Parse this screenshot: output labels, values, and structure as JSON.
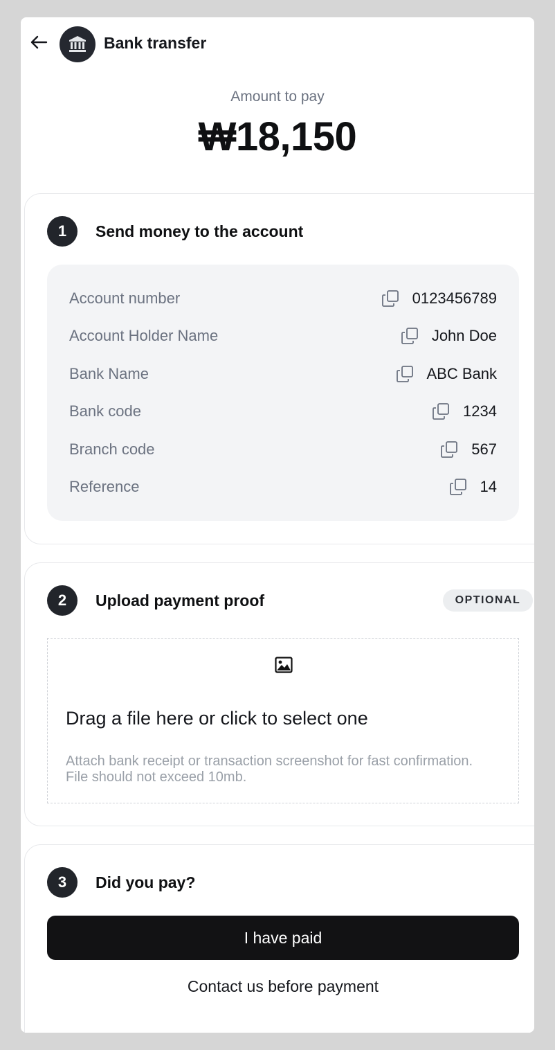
{
  "header": {
    "title": "Bank transfer",
    "back_icon": "arrow-left-icon",
    "avatar_icon": "bank-icon"
  },
  "amount": {
    "label": "Amount to pay",
    "value": "₩18,150"
  },
  "step1": {
    "number": "1",
    "title": "Send money to the account",
    "rows": [
      {
        "label": "Account number",
        "value": "0123456789",
        "icon": "copy-icon"
      },
      {
        "label": "Account Holder Name",
        "value": "John Doe",
        "icon": "copy-icon"
      },
      {
        "label": "Bank Name",
        "value": "ABC Bank",
        "icon": "copy-icon"
      },
      {
        "label": "Bank code",
        "value": "1234",
        "icon": "copy-icon"
      },
      {
        "label": "Branch code",
        "value": "567",
        "icon": "copy-icon"
      },
      {
        "label": "Reference",
        "value": "14",
        "icon": "copy-icon"
      }
    ]
  },
  "step2": {
    "number": "2",
    "title": "Upload payment proof",
    "badge": "OPTIONAL",
    "dropzone": {
      "icon": "image-icon",
      "title": "Drag a file here or click to select one",
      "hint": "Attach bank receipt or transaction screenshot for fast confirmation. File should not exceed 10mb."
    }
  },
  "step3": {
    "number": "3",
    "title": "Did you pay?",
    "primary_button": "I have paid",
    "secondary_link": "Contact us before payment"
  },
  "colors": {
    "background": "#d6d6d6",
    "primary_button": "#121214",
    "step_badge": "#22252b",
    "details_bg": "#f3f4f6",
    "muted_text": "#6b7280"
  }
}
